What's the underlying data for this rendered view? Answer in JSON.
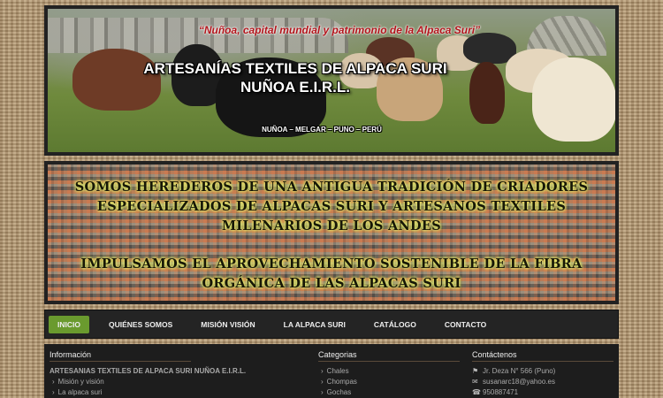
{
  "banner": {
    "slogan": "“Nuñoa, capital mundial y patrimonio de la Alpaca Suri”",
    "title_line1": "ARTESANÍAS TEXTILES DE ALPACA SURI",
    "title_line2": "NUÑOA E.I.R.L.",
    "location": "NUÑOA – MELGAR – PUNO – PERÚ"
  },
  "textile": {
    "paragraph1": "SOMOS HEREDEROS DE UNA ANTIGUA TRADICIÓN DE CRIADORES ESPECIALIZADOS DE ALPACAS SURI Y ARTESANOS TEXTILES MILENARIOS DE LOS ANDES",
    "paragraph2": "IMPULSAMOS EL APROVECHAMIENTO SOSTENIBLE DE LA FIBRA ORGÁNICA DE LAS ALPACAS SURI"
  },
  "nav": {
    "items": [
      "INICIO",
      "QUIÉNES SOMOS",
      "MISIÓN VISIÓN",
      "LA ALPACA SURI",
      "CATÁLOGO",
      "CONTACTO"
    ],
    "active_index": 0,
    "active_color": "#6a9a2e"
  },
  "footer": {
    "info": {
      "heading": "Información",
      "company": "ARTESANIAS TEXTILES DE ALPACA SURI NUÑOA E.I.R.L.",
      "links": [
        "Misión y visión",
        "La alpaca suri"
      ]
    },
    "categories": {
      "heading": "Categorias",
      "links": [
        "Chales",
        "Chompas",
        "Gochas"
      ]
    },
    "contact": {
      "heading": "Contáctenos",
      "address": "Jr. Deza N° 566 (Puno)",
      "email": "susanarc18@yahoo.es",
      "phone": "950887471",
      "icons": [
        "map-marker-icon",
        "envelope-icon",
        "phone-icon"
      ]
    }
  }
}
